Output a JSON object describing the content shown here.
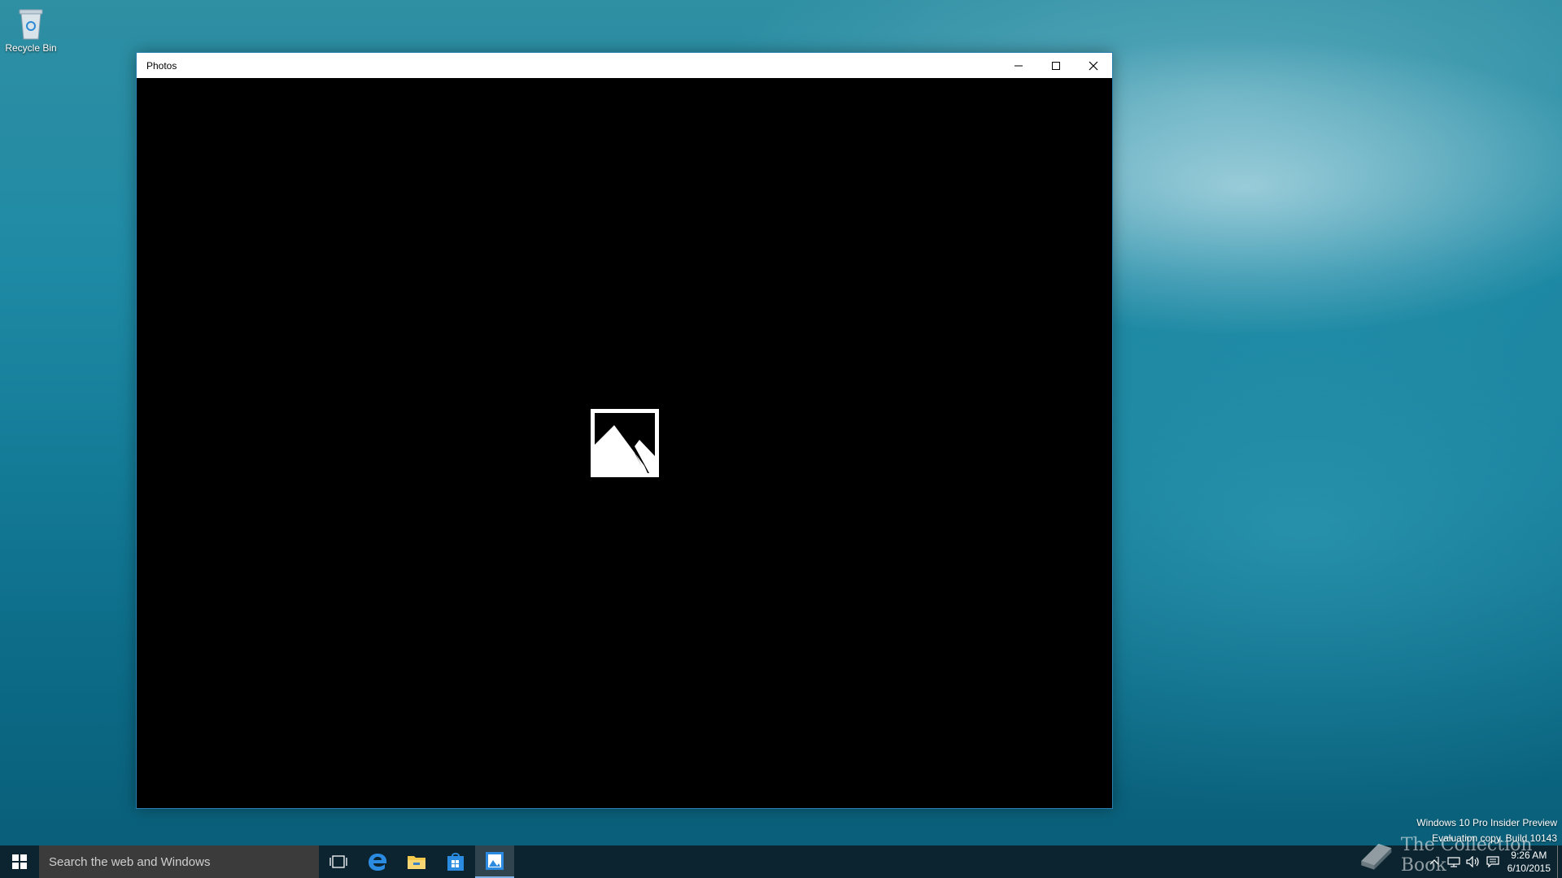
{
  "desktop": {
    "recycle_bin_label": "Recycle Bin"
  },
  "window": {
    "title": "Photos",
    "controls": [
      "minimize",
      "maximize",
      "close"
    ],
    "content_placeholder_icon": "image-placeholder-icon"
  },
  "os_watermark": {
    "line1": "Windows 10 Pro Insider Preview",
    "line2": "Evaluation copy. Build 10143"
  },
  "brand_watermark": "The Collection Book",
  "taskbar": {
    "search_placeholder": "Search the web and Windows",
    "pinned": [
      "task-view-icon",
      "edge-icon",
      "file-explorer-icon",
      "store-icon",
      "photos-icon"
    ],
    "active_app": "Photos"
  },
  "tray": {
    "time": "9:26 AM",
    "date": "6/10/2015",
    "icons": [
      "chevron-up-icon",
      "network-icon",
      "volume-icon",
      "action-center-icon"
    ]
  },
  "colors": {
    "window_border": "#2a7fb0",
    "taskbar_bg": "#0c202a",
    "search_bg": "#3b3b3b",
    "accent": "#7fb3e6"
  }
}
